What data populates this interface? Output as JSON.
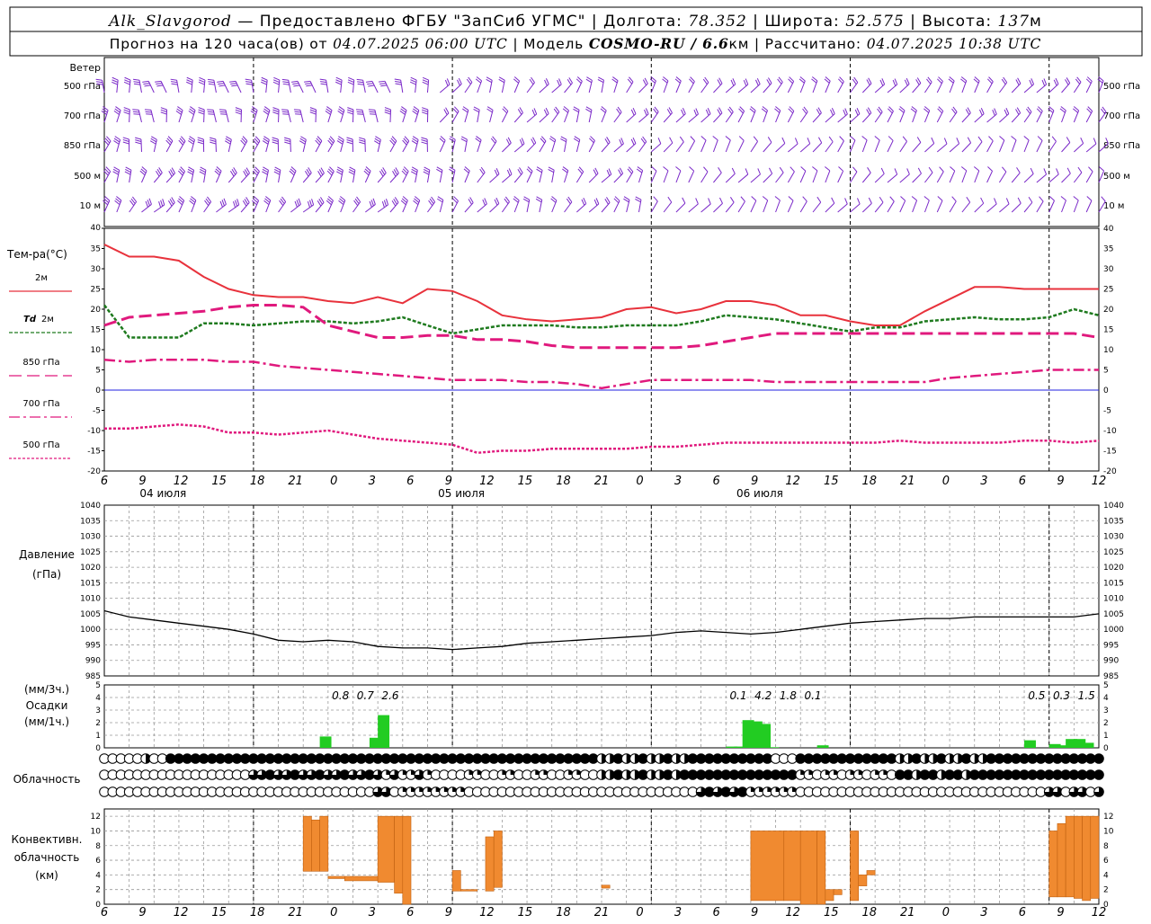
{
  "header": {
    "station": "Alk_Slavgorod",
    "provider_prefix": " — Предоставлено ФГБУ \"ЗапСиб УГМС\" | Долгота: ",
    "lon": "78.352",
    "lat_label": " | Широта: ",
    "lat": "52.575",
    "alt_label": " | Высота: ",
    "alt": "137",
    "alt_unit": "м",
    "forecast_prefix": "Прогноз на 120 часа(ов) от ",
    "forecast_from": "04.07.2025 06:00 UTC",
    "model_label": " | Модель ",
    "model": "COSMO-RU / 6.6",
    "model_unit": "км",
    "calc_label": " | Рассчитано: ",
    "calc_time": "04.07.2025 10:38 UTC"
  },
  "colors": {
    "t2m": "#e8323c",
    "td2m": "#1e7a1e",
    "t850": "#e0197d",
    "t700": "#e0197d",
    "t500": "#e0197d",
    "wind": "#7a28c8",
    "precip": "#22cc22",
    "conv": "#f08a30",
    "pressure": "#000000",
    "zero_line": "#2020e0"
  },
  "wind_panel": {
    "title": "Ветер",
    "levels": [
      "500 гПа",
      "700 гПа",
      "850 гПа",
      "500 м",
      "10 м"
    ]
  },
  "temp_panel": {
    "title": "Тем-ра(°C)",
    "legend": [
      {
        "key": "t2m",
        "label": "2м"
      },
      {
        "key": "td2m",
        "label_prefix": "Td",
        "label": " 2м"
      },
      {
        "key": "t850",
        "label": "850 гПа"
      },
      {
        "key": "t700",
        "label": "700 гПа"
      },
      {
        "key": "t500",
        "label": "500 гПа"
      }
    ],
    "ticks": [
      "40",
      "35",
      "30",
      "25",
      "20",
      "15",
      "10",
      "5",
      "0",
      "-5",
      "-10",
      "-15",
      "-20"
    ]
  },
  "time_axis": {
    "hour_labels": [
      "6",
      "9",
      "12",
      "15",
      "18",
      "21",
      "0",
      "3",
      "6",
      "9",
      "12",
      "15",
      "18",
      "21",
      "0",
      "3",
      "6",
      "9",
      "12",
      "15",
      "18",
      "21",
      "0",
      "3",
      "6",
      "9",
      "12"
    ],
    "day_labels": [
      "04 июля",
      "05 июля",
      "06 июля"
    ]
  },
  "pressure_panel": {
    "title_line1": "Давление",
    "title_line2": "(гПа)",
    "ticks": [
      "1040",
      "1035",
      "1030",
      "1025",
      "1020",
      "1015",
      "1010",
      "1005",
      "1000",
      "995",
      "990",
      "985"
    ]
  },
  "precip_panel": {
    "title_line1": "(мм/3ч.)",
    "title_line2": "Осадки",
    "title_line3": "(мм/1ч.)",
    "ticks": [
      "5",
      "4",
      "3",
      "2",
      "1",
      "0"
    ],
    "totals": [
      {
        "t": 27,
        "label": "0.8"
      },
      {
        "t": 30,
        "label": "0.7"
      },
      {
        "t": 33,
        "label": "2.6"
      },
      {
        "t": 75,
        "label": "0.1"
      },
      {
        "t": 78,
        "label": "4.2"
      },
      {
        "t": 81,
        "label": "1.8"
      },
      {
        "t": 84,
        "label": "0.1"
      },
      {
        "t": 111,
        "label": "0.5"
      },
      {
        "t": 114,
        "label": "0.3"
      },
      {
        "t": 117,
        "label": "1.5"
      }
    ]
  },
  "cloud_panel": {
    "title": "Облачность"
  },
  "conv_panel": {
    "title_line1": "Конвективн.",
    "title_line2": "облачность",
    "title_line3": "(км)",
    "ticks": [
      "12",
      "10",
      "8",
      "6",
      "4",
      "2",
      "0"
    ]
  },
  "chart_data": [
    {
      "type": "line",
      "title": "Тем-ра(°C)",
      "xlabel": "",
      "ylabel": "Тем-ра(°C)",
      "ylim": [
        -20,
        40
      ],
      "x": [
        0,
        3,
        6,
        9,
        12,
        15,
        18,
        21,
        24,
        27,
        30,
        33,
        36,
        39,
        42,
        45,
        48,
        51,
        54,
        57,
        60,
        63,
        66,
        69,
        72,
        75,
        78,
        81,
        84,
        87,
        90,
        93,
        96,
        99,
        102,
        105,
        108,
        111,
        114,
        117,
        120
      ],
      "series": [
        {
          "name": "2м",
          "values": [
            36,
            33,
            33,
            32,
            28,
            25,
            23.5,
            23,
            23,
            22,
            21.5,
            23,
            21.5,
            25,
            24.5,
            22,
            18.5,
            17.5,
            17,
            17.5,
            18,
            20,
            20.5,
            19,
            20,
            22,
            22,
            21,
            18.5,
            18.5,
            17,
            16,
            16,
            19.5,
            22.5,
            25.5,
            25.5,
            25,
            25,
            25,
            25
          ]
        },
        {
          "name": "Td 2м",
          "values": [
            21,
            13,
            13,
            13,
            16.5,
            16.5,
            16,
            16.5,
            17,
            17,
            16.5,
            17,
            18,
            16,
            14,
            15,
            16,
            16,
            16,
            15.5,
            15.5,
            16,
            16,
            16,
            17,
            18.5,
            18,
            17.5,
            16.5,
            15.5,
            14.5,
            15.5,
            15.5,
            17,
            17.5,
            18,
            17.5,
            17.5,
            18,
            20,
            18.5
          ]
        },
        {
          "name": "850 гПа",
          "values": [
            16,
            18,
            18.5,
            19,
            19.5,
            20.5,
            21,
            21,
            20.5,
            16,
            14.5,
            13,
            13,
            13.5,
            13.5,
            12.5,
            12.5,
            12,
            11,
            10.5,
            10.5,
            10.5,
            10.5,
            10.5,
            11,
            12,
            13,
            14,
            14,
            14,
            14,
            14,
            14,
            14,
            14,
            14,
            14,
            14,
            14,
            14,
            13
          ]
        },
        {
          "name": "700 гПа",
          "values": [
            7.5,
            7,
            7.5,
            7.5,
            7.5,
            7,
            7,
            6,
            5.5,
            5,
            4.5,
            4,
            3.5,
            3,
            2.5,
            2.5,
            2.5,
            2,
            2,
            1.5,
            0.5,
            1.5,
            2.5,
            2.5,
            2.5,
            2.5,
            2.5,
            2,
            2,
            2,
            2,
            2,
            2,
            2,
            3,
            3.5,
            4,
            4.5,
            5,
            5,
            5
          ]
        },
        {
          "name": "500 гПа",
          "values": [
            -9.5,
            -9.5,
            -9,
            -8.5,
            -9,
            -10.5,
            -10.5,
            -11,
            -10.5,
            -10,
            -11,
            -12,
            -12.5,
            -13,
            -13.5,
            -15.5,
            -15,
            -15,
            -14.5,
            -14.5,
            -14.5,
            -14.5,
            -14,
            -14,
            -13.5,
            -13,
            -13,
            -13,
            -13,
            -13,
            -13,
            -13,
            -12.5,
            -13,
            -13,
            -13,
            -13,
            -12.5,
            -12.5,
            -13,
            -12.5
          ]
        }
      ]
    },
    {
      "type": "line",
      "title": "Давление",
      "xlabel": "",
      "ylabel": "(гПа)",
      "ylim": [
        985,
        1040
      ],
      "x": [
        0,
        3,
        6,
        9,
        12,
        15,
        18,
        21,
        24,
        27,
        30,
        33,
        36,
        39,
        42,
        45,
        48,
        51,
        54,
        57,
        60,
        63,
        66,
        69,
        72,
        75,
        78,
        81,
        84,
        87,
        90,
        93,
        96,
        99,
        102,
        105,
        108,
        111,
        114,
        117,
        120
      ],
      "series": [
        {
          "name": "",
          "values": [
            1006,
            1004,
            1003,
            1002,
            1001,
            1000,
            998.5,
            996.5,
            996,
            996.5,
            996,
            994.5,
            994,
            994,
            993.5,
            994,
            994.5,
            995.5,
            996,
            996.5,
            997,
            997.5,
            998,
            999,
            999.5,
            999,
            998.5,
            999,
            1000,
            1001,
            1002,
            1002.5,
            1003,
            1003.5,
            1003.5,
            1004,
            1004,
            1004,
            1004,
            1004,
            1005
          ]
        }
      ]
    },
    {
      "type": "bar",
      "title": "Осадки",
      "xlabel": "",
      "ylabel": "(мм/1ч.)",
      "ylim": [
        0,
        5
      ],
      "x": [
        27,
        33,
        34,
        76,
        77,
        78,
        79,
        80,
        81,
        87,
        112,
        115,
        116,
        117,
        118,
        119
      ],
      "values": [
        0.9,
        0.8,
        2.6,
        0.1,
        0.1,
        2.2,
        2.1,
        1.9,
        0.05,
        0.2,
        0.6,
        0.3,
        0.2,
        0.7,
        0.7,
        0.4
      ]
    },
    {
      "type": "bar",
      "title": "Конвективн. облачность",
      "xlabel": "",
      "ylabel": "(км)",
      "ylim": [
        0,
        12
      ],
      "bars": [
        {
          "t0": 24,
          "t1": 25,
          "bottom": 4.5,
          "top": 12
        },
        {
          "t0": 25,
          "t1": 26,
          "bottom": 4.5,
          "top": 11.5
        },
        {
          "t0": 26,
          "t1": 27,
          "bottom": 4.5,
          "top": 12
        },
        {
          "t0": 27,
          "t1": 29,
          "bottom": 3.5,
          "top": 3.8
        },
        {
          "t0": 29,
          "t1": 33,
          "bottom": 3.2,
          "top": 3.8
        },
        {
          "t0": 33,
          "t1": 35,
          "bottom": 3,
          "top": 12
        },
        {
          "t0": 35,
          "t1": 36,
          "bottom": 1.5,
          "top": 12
        },
        {
          "t0": 36,
          "t1": 37,
          "bottom": 0,
          "top": 12
        },
        {
          "t0": 42,
          "t1": 43,
          "bottom": 1.8,
          "top": 4.6
        },
        {
          "t0": 43,
          "t1": 45,
          "bottom": 1.8,
          "top": 2.0
        },
        {
          "t0": 46,
          "t1": 47,
          "bottom": 1.8,
          "top": 9.2
        },
        {
          "t0": 47,
          "t1": 48,
          "bottom": 2.3,
          "top": 10
        },
        {
          "t0": 60,
          "t1": 61,
          "bottom": 2.2,
          "top": 2.6
        },
        {
          "t0": 78,
          "t1": 82,
          "bottom": 0.5,
          "top": 10
        },
        {
          "t0": 82,
          "t1": 84,
          "bottom": 0.5,
          "top": 10
        },
        {
          "t0": 84,
          "t1": 86,
          "bottom": 0,
          "top": 10
        },
        {
          "t0": 86,
          "t1": 87,
          "bottom": 0,
          "top": 10
        },
        {
          "t0": 87,
          "t1": 88,
          "bottom": 0.5,
          "top": 2.0
        },
        {
          "t0": 88,
          "t1": 89,
          "bottom": 1.3,
          "top": 2.0
        },
        {
          "t0": 90,
          "t1": 91,
          "bottom": 0.5,
          "top": 10
        },
        {
          "t0": 91,
          "t1": 92,
          "bottom": 2.5,
          "top": 4.0
        },
        {
          "t0": 92,
          "t1": 93,
          "bottom": 4.0,
          "top": 4.6
        },
        {
          "t0": 114,
          "t1": 115,
          "bottom": 1,
          "top": 10
        },
        {
          "t0": 115,
          "t1": 116,
          "bottom": 1,
          "top": 11
        },
        {
          "t0": 116,
          "t1": 117,
          "bottom": 1,
          "top": 12
        },
        {
          "t0": 117,
          "t1": 118,
          "bottom": 0.8,
          "top": 12
        },
        {
          "t0": 118,
          "t1": 119,
          "bottom": 0.5,
          "top": 12
        },
        {
          "t0": 119,
          "t1": 120,
          "bottom": 0.8,
          "top": 12
        }
      ]
    }
  ]
}
